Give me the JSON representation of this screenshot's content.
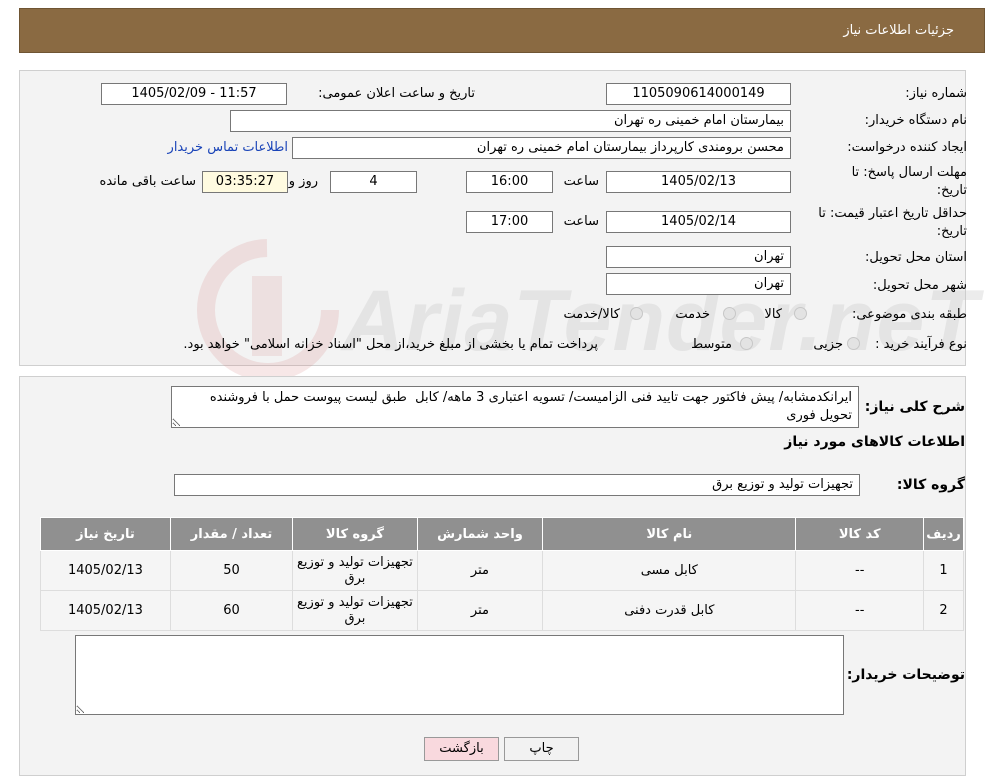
{
  "header": {
    "title": "جزئیات اطلاعات نیاز"
  },
  "form": {
    "need_number_label": "شماره نیاز:",
    "need_number": "1105090614000149",
    "announce_label": "تاریخ و ساعت اعلان عمومی:",
    "announce_value": "1405/02/09 - 11:57",
    "buyer_org_label": "نام دستگاه خریدار:",
    "buyer_org": "بیمارستان امام خمینی ره  تهران",
    "creator_label": "ایجاد کننده درخواست:",
    "creator": "محسن برومندی کارپرداز بیمارستان امام خمینی ره  تهران",
    "contact_link": "اطلاعات تماس خریدار",
    "deadline_label_1": "مهلت ارسال پاسخ: تا",
    "deadline_label_2": "تاریخ:",
    "deadline_date": "1405/02/13",
    "time_label": "ساعت",
    "deadline_time": "16:00",
    "days": "4",
    "days_label": "روز و",
    "remaining": "03:35:27",
    "remaining_label": "ساعت باقی مانده",
    "validity_label_1": "حداقل تاریخ اعتبار قیمت: تا",
    "validity_label_2": "تاریخ:",
    "validity_date": "1405/02/14",
    "validity_time": "17:00",
    "province_label": "استان محل تحویل:",
    "province": "تهران",
    "city_label": "شهر محل تحویل:",
    "city": "تهران",
    "category_label": "طبقه بندی موضوعی:",
    "category_options": [
      "کالا",
      "خدمت",
      "کالا/خدمت"
    ],
    "process_label": "نوع فرآیند خرید :",
    "process_options": [
      "جزیی",
      "متوسط"
    ],
    "process_note": "پرداخت تمام یا بخشی از مبلغ خرید،از محل \"اسناد خزانه اسلامی\" خواهد بود."
  },
  "description": {
    "label": "شرح کلی نیاز:",
    "text": "ایرانکدمشابه/ پیش فاکتور جهت تایید فنی الزامیست/ تسویه اعتباری 3 ماهه/ کابل  طبق لیست پیوست حمل با فروشنده تحویل فوری"
  },
  "goods": {
    "section_title": "اطلاعات کالاهای مورد نیاز",
    "group_label": "گروه کالا:",
    "group_value": "تجهیزات تولید و توزیع برق",
    "columns": [
      "ردیف",
      "کد کالا",
      "نام کالا",
      "واحد شمارش",
      "گروه کالا",
      "تعداد / مقدار",
      "تاریخ نیاز"
    ],
    "rows": [
      [
        "1",
        "--",
        "کابل مسی",
        "متر",
        "تجهیزات تولید و توزیع برق",
        "50",
        "1405/02/13"
      ],
      [
        "2",
        "--",
        "کابل قدرت دفنی",
        "متر",
        "تجهیزات تولید و توزیع برق",
        "60",
        "1405/02/13"
      ]
    ]
  },
  "buyer_notes": {
    "label": "توضیحات خریدار:",
    "value": ""
  },
  "buttons": {
    "print": "چاپ",
    "back": "بازگشت"
  },
  "watermark": {
    "text": "AriaTender.neT"
  },
  "colors": {
    "header_bg": "#8a6a42",
    "table_header_bg": "#909090",
    "link": "#1a44b8",
    "back_button_bg": "#f9d9de"
  }
}
